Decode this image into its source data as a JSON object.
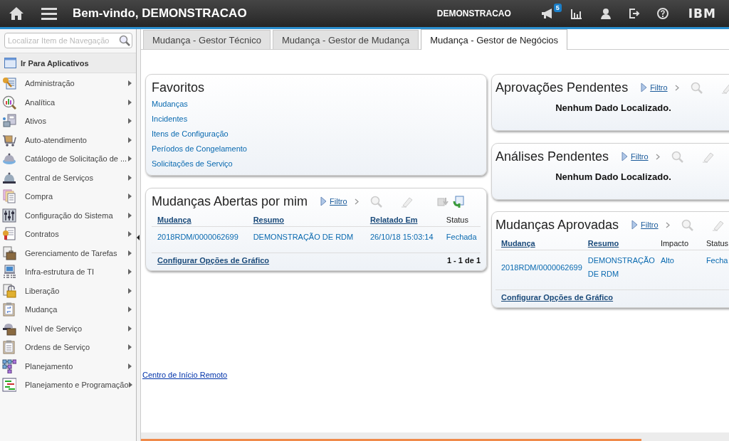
{
  "header": {
    "title": "Bem-vindo, DEMONSTRACAO",
    "user": "DEMONSTRACAO",
    "notifications_badge": "5",
    "logo": "IBM"
  },
  "sidebar": {
    "search": {
      "placeholder": "Localizar Item de Navegação"
    },
    "go_to_apps": "Ir Para Aplicativos",
    "items": [
      {
        "label": "Administração"
      },
      {
        "label": "Analítica"
      },
      {
        "label": "Ativos"
      },
      {
        "label": "Auto-atendimento"
      },
      {
        "label": "Catálogo de Solicitação de ..."
      },
      {
        "label": "Central de Serviços"
      },
      {
        "label": "Compra"
      },
      {
        "label": "Configuração do Sistema"
      },
      {
        "label": "Contratos"
      },
      {
        "label": "Gerenciamento de Tarefas"
      },
      {
        "label": "Infra-estrutura de TI"
      },
      {
        "label": "Liberação"
      },
      {
        "label": "Mudança"
      },
      {
        "label": "Nível de Serviço"
      },
      {
        "label": "Ordens de Serviço"
      },
      {
        "label": "Planejamento"
      },
      {
        "label": "Planejamento e Programação"
      }
    ]
  },
  "tabs": [
    {
      "label": "Mudança - Gestor Técnico",
      "selected": false
    },
    {
      "label": "Mudança - Gestor de Mudança",
      "selected": false
    },
    {
      "label": "Mudança - Gestor de Negócios",
      "selected": true
    }
  ],
  "portlets_left": [
    {
      "kind": "links",
      "title": "Favoritos",
      "links": [
        "Mudanças",
        "Incidentes",
        "Itens de Configuração",
        "Períodos de Congelamento",
        "Solicitações de Serviço"
      ]
    },
    {
      "kind": "table",
      "title": "Mudanças Abertas por mim",
      "filter": "Filtro",
      "columns": [
        {
          "label": "Mudança",
          "sortable": true
        },
        {
          "label": "Resumo",
          "sortable": true
        },
        {
          "label": "Relatado Em",
          "sortable": true
        },
        {
          "label": "Status",
          "sortable": false
        }
      ],
      "rows": [
        [
          "2018RDM/0000062699",
          "DEMONSTRAÇÃO DE RDM",
          "26/10/18 15:03:14",
          "Fechada"
        ]
      ],
      "footer_link": "Configurar Opções de Gráfico",
      "count": "1 - 1 de 1"
    }
  ],
  "remote_link": "Centro de Início Remoto",
  "portlets_right": [
    {
      "kind": "empty",
      "title": "Aprovações Pendentes",
      "filter": "Filtro",
      "message": "Nenhum Dado Localizado."
    },
    {
      "kind": "empty",
      "title": "Análises Pendentes",
      "filter": "Filtro",
      "message": "Nenhum Dado Localizado."
    },
    {
      "kind": "table",
      "title": "Mudanças Aprovadas",
      "filter": "Filtro",
      "columns": [
        {
          "label": "Mudança",
          "sortable": true
        },
        {
          "label": "Resumo",
          "sortable": true
        },
        {
          "label": "Impacto",
          "sortable": false
        },
        {
          "label": "Status",
          "sortable": false
        }
      ],
      "rows": [
        [
          "2018RDM/0000062699",
          "DEMONSTRAÇÃO DE RDM",
          "Alto",
          "Fecha"
        ]
      ],
      "footer_link": "Configurar Opções de Gráfico"
    }
  ]
}
